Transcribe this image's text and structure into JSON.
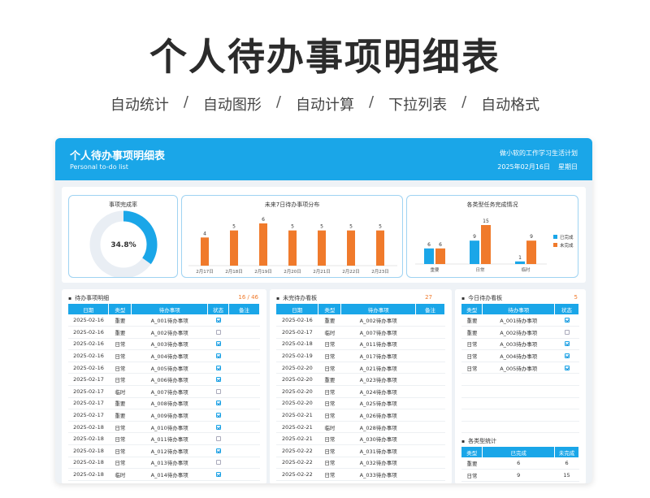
{
  "hero": {
    "title": "个人待办事项明细表",
    "features": [
      "自动统计",
      "自动图形",
      "自动计算",
      "下拉列表",
      "自动格式"
    ]
  },
  "header": {
    "title": "个人待办事项明细表",
    "subtitle": "Personal to-do list",
    "right_line1": "做小软的工作学习生活计划",
    "date": "2025年02月16日",
    "weekday": "星期日"
  },
  "colors": {
    "primary": "#1aa6e8",
    "accent": "#f07a2b",
    "track": "#e9eef4"
  },
  "completion": {
    "title": "事项完成率",
    "rate_label": "34.8%",
    "rate": 0.348
  },
  "chart_data": [
    {
      "type": "bar",
      "title": "未来7日待办事项分布",
      "categories": [
        "2月17日",
        "2月18日",
        "2月19日",
        "2月20日",
        "2月21日",
        "2月22日",
        "2月23日"
      ],
      "values": [
        4,
        5,
        6,
        5,
        5,
        5,
        5
      ],
      "ylim": [
        0,
        6
      ]
    },
    {
      "type": "bar",
      "title": "各类型任务完成情况",
      "categories": [
        "重要",
        "日常",
        "临时"
      ],
      "series": [
        {
          "name": "已完成",
          "values": [
            6,
            9,
            1
          ]
        },
        {
          "name": "未完成",
          "values": [
            6,
            15,
            9
          ]
        }
      ],
      "ylim": [
        0,
        15
      ],
      "legend": "right"
    }
  ],
  "todo_detail": {
    "title": "待办事项明细",
    "count": "16 / 46",
    "columns": [
      "日期",
      "类型",
      "待办事项",
      "状态",
      "备注"
    ],
    "rows": [
      [
        "2025-02-16",
        "重要",
        "A_001待办事项",
        true,
        ""
      ],
      [
        "2025-02-16",
        "重要",
        "A_002待办事项",
        false,
        ""
      ],
      [
        "2025-02-16",
        "日常",
        "A_003待办事项",
        true,
        ""
      ],
      [
        "2025-02-16",
        "日常",
        "A_004待办事项",
        true,
        ""
      ],
      [
        "2025-02-16",
        "日常",
        "A_005待办事项",
        true,
        ""
      ],
      [
        "2025-02-17",
        "日常",
        "A_006待办事项",
        true,
        ""
      ],
      [
        "2025-02-17",
        "临时",
        "A_007待办事项",
        false,
        ""
      ],
      [
        "2025-02-17",
        "重要",
        "A_008待办事项",
        true,
        ""
      ],
      [
        "2025-02-17",
        "重要",
        "A_009待办事项",
        true,
        ""
      ],
      [
        "2025-02-18",
        "日常",
        "A_010待办事项",
        true,
        ""
      ],
      [
        "2025-02-18",
        "日常",
        "A_011待办事项",
        false,
        ""
      ],
      [
        "2025-02-18",
        "日常",
        "A_012待办事项",
        true,
        ""
      ],
      [
        "2025-02-18",
        "日常",
        "A_013待办事项",
        false,
        ""
      ],
      [
        "2025-02-18",
        "临时",
        "A_014待办事项",
        true,
        ""
      ]
    ]
  },
  "pending_board": {
    "title": "未完待办看板",
    "count": "27",
    "columns": [
      "日期",
      "类型",
      "待办事项",
      "备注"
    ],
    "rows": [
      [
        "2025-02-16",
        "重要",
        "A_002待办事项",
        ""
      ],
      [
        "2025-02-17",
        "临时",
        "A_007待办事项",
        ""
      ],
      [
        "2025-02-18",
        "日常",
        "A_011待办事项",
        ""
      ],
      [
        "2025-02-19",
        "日常",
        "A_017待办事项",
        ""
      ],
      [
        "2025-02-20",
        "日常",
        "A_021待办事项",
        ""
      ],
      [
        "2025-02-20",
        "重要",
        "A_023待办事项",
        ""
      ],
      [
        "2025-02-20",
        "日常",
        "A_024待办事项",
        ""
      ],
      [
        "2025-02-20",
        "日常",
        "A_025待办事项",
        ""
      ],
      [
        "2025-02-21",
        "日常",
        "A_026待办事项",
        ""
      ],
      [
        "2025-02-21",
        "临时",
        "A_028待办事项",
        ""
      ],
      [
        "2025-02-21",
        "日常",
        "A_030待办事项",
        ""
      ],
      [
        "2025-02-22",
        "日常",
        "A_031待办事项",
        ""
      ],
      [
        "2025-02-22",
        "日常",
        "A_032待办事项",
        ""
      ],
      [
        "2025-02-22",
        "日常",
        "A_033待办事项",
        ""
      ]
    ]
  },
  "today_board": {
    "title": "今日待办看板",
    "count": "5",
    "columns": [
      "类型",
      "待办事项",
      "状态"
    ],
    "rows": [
      [
        "重要",
        "A_001待办事项",
        true
      ],
      [
        "重要",
        "A_002待办事项",
        false
      ],
      [
        "日常",
        "A_003待办事项",
        true
      ],
      [
        "日常",
        "A_004待办事项",
        true
      ],
      [
        "日常",
        "A_005待办事项",
        true
      ]
    ]
  },
  "type_stats": {
    "title": "各类型统计",
    "columns": [
      "类型",
      "已完成",
      "未完成"
    ],
    "rows": [
      [
        "重要",
        "6",
        "6"
      ],
      [
        "日常",
        "9",
        "15"
      ]
    ]
  }
}
